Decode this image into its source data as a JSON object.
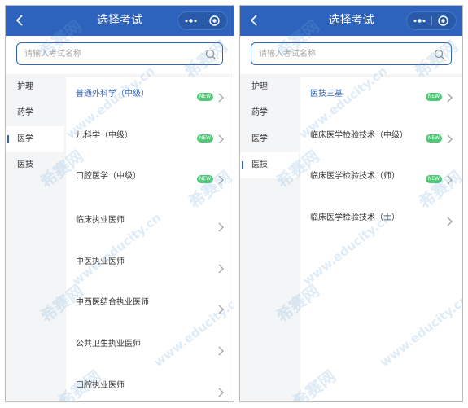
{
  "nav": {
    "title": "选择考试"
  },
  "search": {
    "placeholder": "请输入考试名称"
  },
  "sidebar": [
    {
      "label": "护理"
    },
    {
      "label": "药学"
    },
    {
      "label": "医学"
    },
    {
      "label": "医技"
    }
  ],
  "left_screen": {
    "active_category": "医学",
    "exams": [
      {
        "label": "普通外科学（中级）",
        "new": true,
        "selected": true
      },
      {
        "label": "儿科学（中级）",
        "new": true
      },
      {
        "label": "口腔医学（中级）",
        "new": true
      },
      {
        "label": "临床执业医师",
        "new": false
      },
      {
        "label": "中医执业医师",
        "new": false
      },
      {
        "label": "中西医结合执业医师",
        "new": false
      },
      {
        "label": "公共卫生执业医师",
        "new": false
      },
      {
        "label": "口腔执业医师",
        "new": false
      }
    ]
  },
  "right_screen": {
    "active_category": "医技",
    "exams": [
      {
        "label": "医技三基",
        "new": true,
        "selected": true
      },
      {
        "label": "临床医学检验技术（中级）",
        "new": true
      },
      {
        "label": "临床医学检验技术（师）",
        "new": true
      },
      {
        "label": "临床医学检验技术（士）",
        "new": false
      }
    ]
  },
  "badge_text": "NEW",
  "watermark": {
    "cn": "希赛网",
    "en": "www.educity.cn"
  },
  "icons": {
    "back": "chevron-left-icon",
    "more": "more-dots-icon",
    "close": "target-circle-icon",
    "search": "search-icon",
    "row_arrow": "chevron-right-icon"
  },
  "colors": {
    "primary": "#2e63bd",
    "badge": "#50c878",
    "sidebar_bg": "#f4f5f7",
    "text": "#333333"
  }
}
